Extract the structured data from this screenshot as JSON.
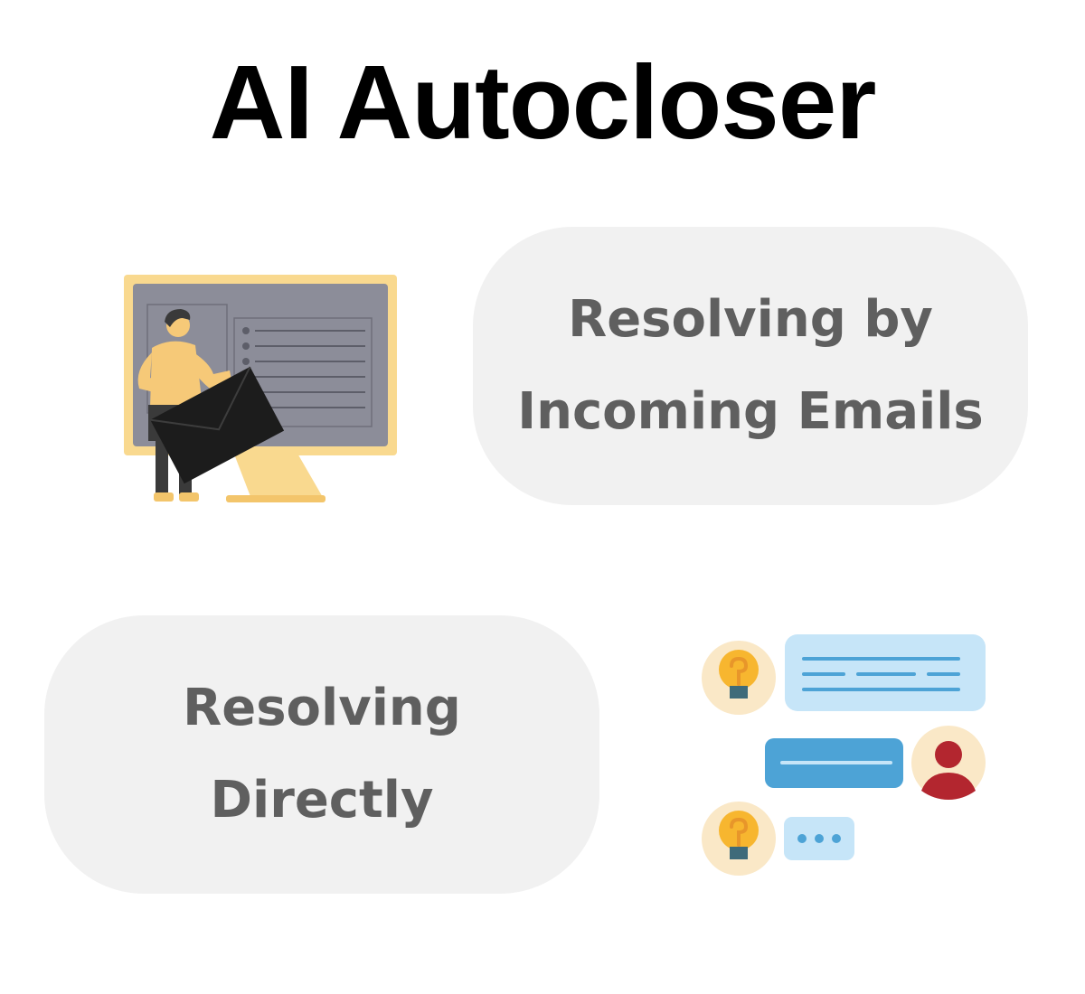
{
  "title": "AI Autocloser",
  "cards": [
    {
      "line1": "Resolving by",
      "line2": "Incoming Emails",
      "illustration": "person-with-envelope-at-monitor-icon"
    },
    {
      "line1": "Resolving",
      "line2": "Directly",
      "illustration": "chat-conversation-icon"
    }
  ],
  "colors": {
    "pill_bg": "#f1f1f1",
    "pill_text": "#5f5f5f",
    "monitor_frame": "#f9d98f",
    "monitor_screen": "#8c8d99",
    "envelope": "#1c1c1c",
    "bubble_light": "#c6e5f8",
    "bubble_dark": "#4da3d6",
    "bulb_circle": "#fae8c7",
    "bulb": "#f7b62f",
    "avatar": "#b3262f"
  }
}
